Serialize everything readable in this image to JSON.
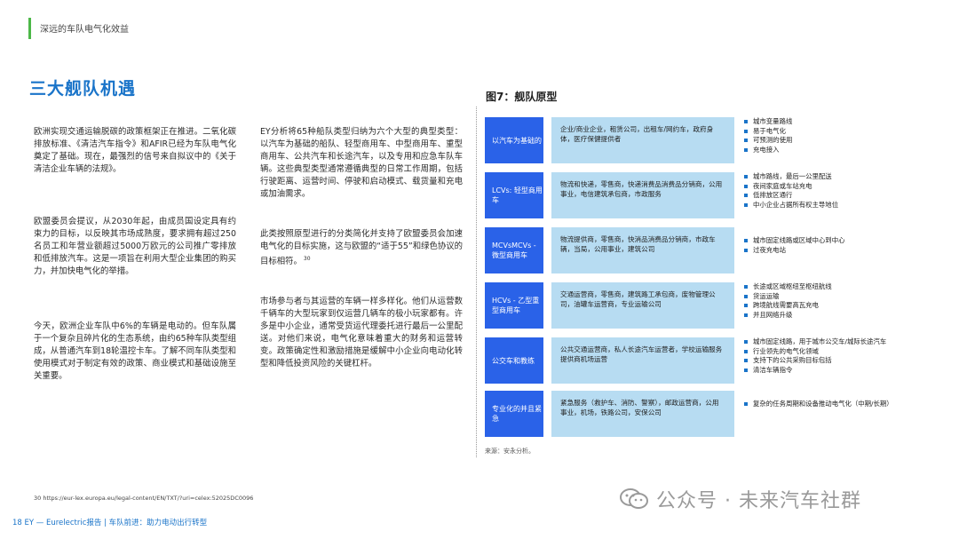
{
  "header": {
    "section_title": "深远的车队电气化效益"
  },
  "main_heading": "三大舰队机遇",
  "left_column": {
    "paragraphs": [
      "欧洲实现交通运输脱碳的政策框架正在推进。二氧化碳排放标准、《清洁汽车指令》和AFIR已经为车队电气化奠定了基础。现在，最强烈的信号来自拟议中的《关于清洁企业车辆的法规》。",
      "欧盟委员会提议，从2030年起，由成员国设定具有约束力的目标，以反映其市场成熟度，要求拥有超过250名员工和年营业额超过5000万欧元的公司推广零排放和低排放汽车。这是一项旨在利用大型企业集团的购买力，并加快电气化的举措。",
      "今天，欧洲企业车队中6%的车辆是电动的。但车队属于一个复杂且碎片化的生态系统，由约65种车队类型组成，从普通汽车到18轮温控卡车。了解不同车队类型和使用模式对于制定有效的政策、商业模式和基础设施至关重要。"
    ]
  },
  "middle_column": {
    "paragraphs": [
      "EY分析将65种船队类型归纳为六个大型的典型类型：以汽车为基础的船队、轻型商用车、中型商用车、重型商用车、公共汽车和长途汽车，以及专用和应急车队车辆。这些典型类型通常遵循典型的日常工作周期，包括行驶距离、运营时间、停驶和启动模式、载货量和充电或加油需求。",
      "此类按照原型进行的分类简化并支持了欧盟委员会加速电气化的目标实施，这与欧盟的“适于55”和绿色协议的目标相符。",
      "市场参与者与其运营的车辆一样多样化。他们从运营数千辆车的大型玩家到仅运营几辆车的极小玩家都有。许多是中小企业，通常受货运代理委托进行最后一公里配送。对他们来说，电气化意味着重大的财务和运营转变。政策确定性和激励措施是缓解中小企业向电动化转型和降低投资风险的关键杠杆。"
    ],
    "superscript": "30"
  },
  "figure": {
    "title": "图7：舰队原型",
    "rows": [
      {
        "label": "以汽车为基础的",
        "users": "企业/商业企业，租赁公司，出租车/网约车，政府身体，医疗保健提供者",
        "bullets": [
          "城市变量路线",
          "易于电气化",
          "可预测的使用",
          "充电接入"
        ]
      },
      {
        "label": "LCVs: 轻型商用车",
        "users": "物流和快递，零售商，快递消费品消费品分销商，公用事业，电信建筑承包商，市政服务",
        "bullets": [
          "城市路线，最后一公里配送",
          "夜间家庭或车站充电",
          "低排放区通行",
          "中小企业占据所有权主导地位"
        ]
      },
      {
        "label": "MCVsMCVs - 微型商用车",
        "users": "物流提供商，零售商，快消品消费品分销商，市政车辆，当局，公用事业，建筑公司",
        "bullets": [
          "城市固定线路或区域中心到中心",
          "过夜充电站"
        ]
      },
      {
        "label": "HCVs - 乙型重型商用车",
        "users": "交通运营商，零售商，建筑路工承包商，废物管理公司，油罐车运营商，专业运输公司",
        "bullets": [
          "长途或区域枢纽至枢纽航线",
          "货运运输",
          "跨境航线需要高瓦充电",
          "并且网络升级"
        ]
      },
      {
        "label": "公交车和教练",
        "users": "公共交通运营商，私人长途汽车运营者，学校运输服务提供商机场运营",
        "bullets": [
          "城市固定线路，用于城市公交车/城际长途汽车",
          "行业领先的电气化领域",
          "支持下的公共采购目标包括",
          "清洁车辆指令"
        ]
      },
      {
        "label": "专业化的并且紧急",
        "users": "紧急服务（救护车、消防、警察），邮政运营商，公用事业，机场，铁路公司，安保公司",
        "bullets": [
          "复杂的任务周期和设备推动电气化（中期/长期）"
        ]
      }
    ],
    "source": "来源：安永分析。"
  },
  "footnote": "30  https://eur-lex.europa.eu/legal-content/EN/TXT/?uri=celex:52025DC0096",
  "footer": "18 EY — Eurelectric报告 | 车队前进：助力电动出行转型",
  "watermark": "公众号 · 未来汽车社群",
  "colors": {
    "accent_blue": "#1a74c9",
    "label_blue": "#2a62e8",
    "light_blue": "#b7dcf2",
    "green_bar": "#4cb848"
  }
}
